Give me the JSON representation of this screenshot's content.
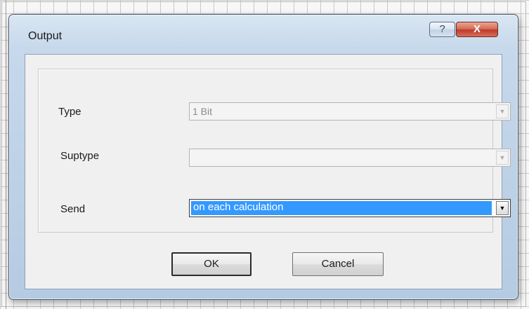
{
  "dialog": {
    "title": "Output",
    "help_label": "?",
    "close_label": "X"
  },
  "form": {
    "type": {
      "label": "Type",
      "value": "1 Bit"
    },
    "subtype": {
      "label": "Suptype",
      "value": ""
    },
    "send": {
      "label": "Send",
      "value": "on each calculation"
    },
    "dropdown_arrow": "▼"
  },
  "buttons": {
    "ok_label": "OK",
    "cancel_label": "Cancel"
  }
}
